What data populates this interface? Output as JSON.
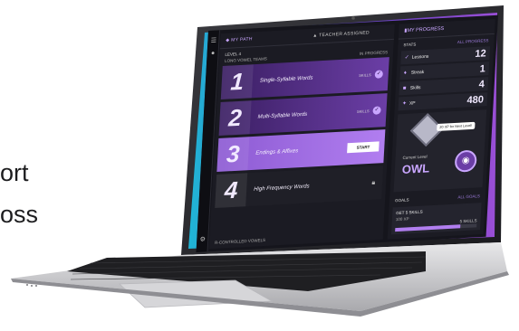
{
  "page_text": {
    "line1": "ort",
    "line2": "oss"
  },
  "rail": {
    "menu_icon": "menu-icon",
    "user_icon": "user-icon",
    "settings_icon": "gear-icon"
  },
  "path_panel": {
    "tab_path": "MY PATH",
    "tab_teacher": "TEACHER ASSIGNED",
    "level": "LEVEL 4",
    "level_sub": "LONG VOWEL TEAMS",
    "status": "IN PROGRESS",
    "units": [
      {
        "number": "1",
        "title": "Single-Syllable Words",
        "skills": "SKILLS",
        "state": "done"
      },
      {
        "number": "2",
        "title": "Multi-Syllable Words",
        "skills": "SKILLS",
        "state": "done"
      },
      {
        "number": "3",
        "title": "Endings & Affixes",
        "button": "START",
        "state": "active"
      },
      {
        "number": "4",
        "title": "High Frequency Words",
        "state": "locked"
      }
    ],
    "footer": "R-CONTROLLED VOWELS"
  },
  "progress_panel": {
    "title": "MY PROGRESS",
    "stats_label": "STATS",
    "all_progress": "ALL PROGRESS",
    "stats": [
      {
        "icon": "check-icon",
        "label": "Lessons",
        "value": "12"
      },
      {
        "icon": "flame-icon",
        "label": "Streak",
        "value": "1"
      },
      {
        "icon": "bookmark-icon",
        "label": "Skills",
        "value": "4"
      },
      {
        "icon": "star-icon",
        "label": "XP",
        "value": "480"
      }
    ],
    "next_level_tip": "20 XP for Next Level!",
    "current_level_label": "Current Level",
    "current_level": "OWL",
    "goals_label": "GOALS",
    "all_goals": "ALL GOALS",
    "goal": {
      "title": "GET 5 SKILLS",
      "xp": "100 XP",
      "count": "5 SKILLS",
      "progress": 0.8
    }
  }
}
